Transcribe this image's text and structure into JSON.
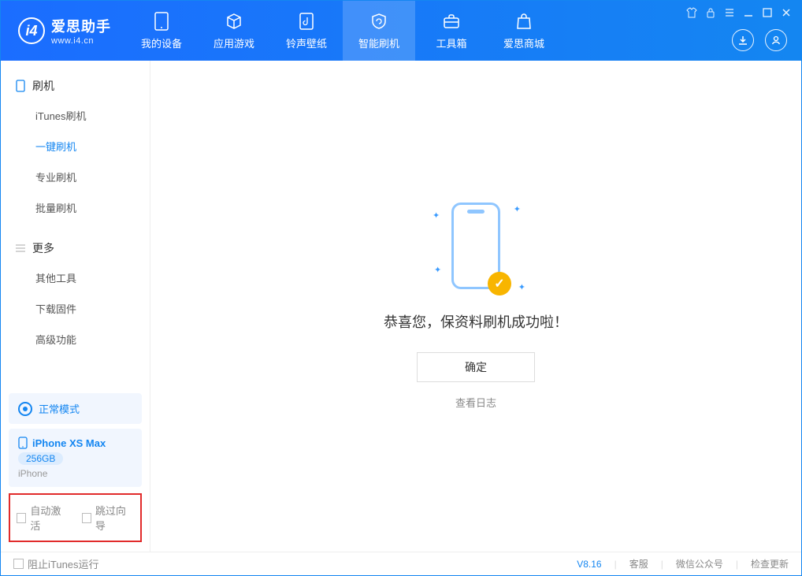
{
  "logo": {
    "title": "爱思助手",
    "subtitle": "www.i4.cn"
  },
  "tabs": {
    "device": "我的设备",
    "apps": "应用游戏",
    "ring": "铃声壁纸",
    "flash": "智能刷机",
    "tools": "工具箱",
    "store": "爱思商城"
  },
  "sidebar": {
    "section1": "刷机",
    "items1": {
      "itunes": "iTunes刷机",
      "oneclick": "一键刷机",
      "pro": "专业刷机",
      "batch": "批量刷机"
    },
    "section2": "更多",
    "items2": {
      "other": "其他工具",
      "firmware": "下载固件",
      "advanced": "高级功能"
    }
  },
  "mode": {
    "label": "正常模式"
  },
  "device": {
    "name": "iPhone XS Max",
    "storage": "256GB",
    "type": "iPhone"
  },
  "options": {
    "auto_activate": "自动激活",
    "skip_wizard": "跳过向导"
  },
  "main": {
    "success": "恭喜您，保资料刷机成功啦！",
    "ok": "确定",
    "log": "查看日志"
  },
  "footer": {
    "stop_itunes": "阻止iTunes运行",
    "version": "V8.16",
    "service": "客服",
    "wechat": "微信公众号",
    "update": "检查更新"
  }
}
